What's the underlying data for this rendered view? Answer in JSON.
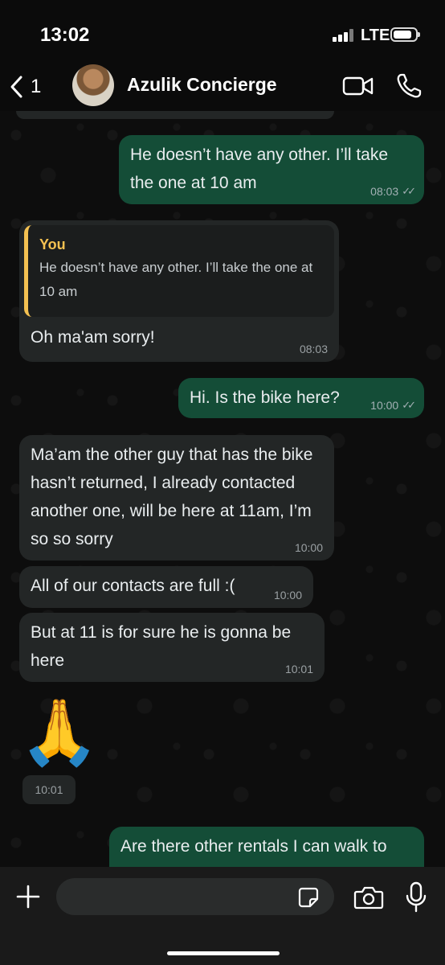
{
  "status_bar": {
    "time": "13:02",
    "network": "LTE"
  },
  "header": {
    "back_count": "1",
    "contact_name": "Azulik Concierge"
  },
  "messages": [
    {
      "direction": "out",
      "text": "He doesn’t have any other. I’ll take the one at 10 am",
      "time": "08:03",
      "read": true
    },
    {
      "direction": "in",
      "reply_to": {
        "author": "You",
        "text": "He doesn’t have any other. I’ll take the one at 10 am"
      },
      "text": "Oh ma'am sorry!",
      "time": "08:03"
    },
    {
      "direction": "out",
      "text": "Hi. Is the bike here?",
      "time": "10:00",
      "read": true
    },
    {
      "direction": "in",
      "text": "Ma’am the other guy that has the bike hasn’t returned, I already contacted another one, will be here at 11am, I’m so so sorry",
      "time": "10:00"
    },
    {
      "direction": "in",
      "text": "All of our contacts are full :(",
      "time": "10:00"
    },
    {
      "direction": "in",
      "text": "But at 11 is for sure he is gonna be here",
      "time": "10:01"
    },
    {
      "direction": "in",
      "emoji": "🙏",
      "time": "10:01"
    },
    {
      "direction": "out",
      "text": "Are there other rentals I can walk to"
    }
  ],
  "input": {
    "value": ""
  },
  "colors": {
    "outgoing_bubble": "#144d37",
    "incoming_bubble": "#232626",
    "reply_accent": "#f4c151",
    "background": "#0b0b0b"
  },
  "icons": [
    "back-chevron-icon",
    "video-call-icon",
    "phone-icon",
    "chevron-down-icon",
    "plus-icon",
    "sticker-icon",
    "camera-icon",
    "mic-icon"
  ]
}
